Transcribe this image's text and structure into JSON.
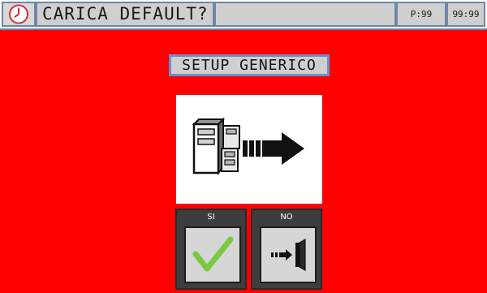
{
  "topbar": {
    "icon": "clock-icon",
    "title": "CARICA DEFAULT?",
    "page_indicator": "P:99",
    "time_indicator": "99:99"
  },
  "heading": "SETUP GENERICO",
  "panel": {
    "icon": "file-cabinet-export-arrow-icon"
  },
  "buttons": {
    "yes": {
      "label": "SI",
      "icon": "checkmark-icon"
    },
    "no": {
      "label": "NO",
      "icon": "exit-door-icon"
    }
  },
  "colors": {
    "background": "#ff0000",
    "frame": "#6d86a8",
    "checkmark": "#7ac943"
  }
}
